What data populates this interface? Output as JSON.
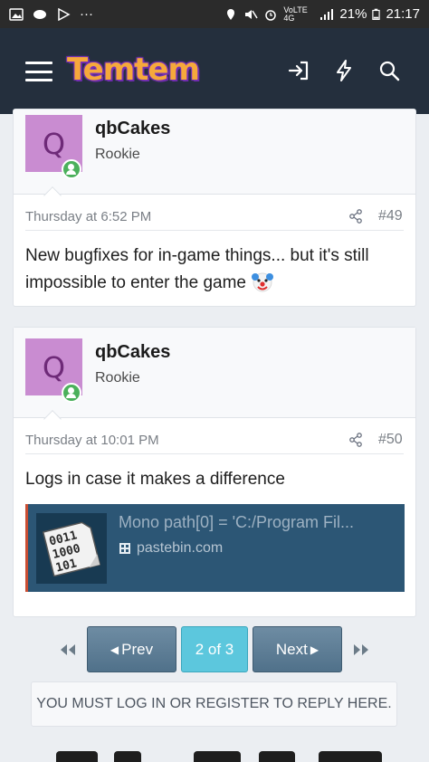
{
  "status_bar": {
    "signal_text": "VoLTE 4G",
    "battery": "21%",
    "time": "21:17"
  },
  "header": {
    "logo_text": "Temtem",
    "icons": [
      "hamburger-menu-icon",
      "login-icon",
      "bolt-icon",
      "search-icon"
    ]
  },
  "posts": [
    {
      "avatar_letter": "Q",
      "username": "qbCakes",
      "user_title": "Rookie",
      "date": "Thursday at 6:52 PM",
      "post_number": "#49",
      "body": "New bugfixes for in-game things... but it's still impossible to enter the game"
    },
    {
      "avatar_letter": "Q",
      "username": "qbCakes",
      "user_title": "Rookie",
      "date": "Thursday at 10:01 PM",
      "post_number": "#50",
      "body": "Logs in case it makes a difference",
      "embed": {
        "title": "Mono path[0] = 'C:/Program Fil...",
        "site": "pastebin.com",
        "thumb_text": "0011 1000 101",
        "accent_color": "#c94e33",
        "background_color": "#2c5675"
      }
    }
  ],
  "pagination": {
    "prev_label": "Prev",
    "current_label": "2 of 3",
    "next_label": "Next"
  },
  "reply_notice": "YOU MUST LOG IN OR REGISTER TO REPLY HERE."
}
